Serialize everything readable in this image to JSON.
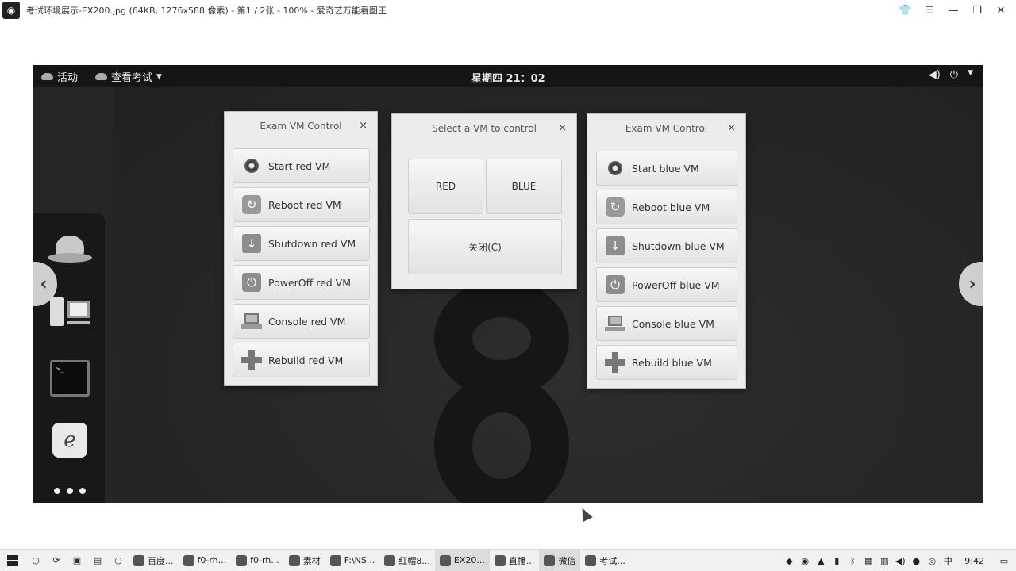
{
  "viewer": {
    "title": "考试环境展示-EX200.jpg (64KB, 1276x588 像素) - 第1 / 2张 - 100% - 爱奇艺万能看图王",
    "controls": [
      "shirt-icon",
      "menu-icon",
      "minimize-icon",
      "restore-icon",
      "close-icon"
    ]
  },
  "gnome": {
    "activities": "活动",
    "app_menu": "查看考试",
    "clock": "星期四 21：02",
    "volume_icon": "◀)",
    "power_icon": "⏻"
  },
  "dialogs": {
    "red": {
      "title": "Exam VM Control",
      "close": "×",
      "buttons": [
        {
          "label": "Start  red  VM",
          "icon": "start-icon"
        },
        {
          "label": "Reboot  red  VM",
          "icon": "reboot-icon"
        },
        {
          "label": "Shutdown  red  VM",
          "icon": "shutdown-icon"
        },
        {
          "label": "PowerOff  red  VM",
          "icon": "poweroff-icon"
        },
        {
          "label": "Console  red  VM",
          "icon": "console-icon"
        },
        {
          "label": "Rebuild  red  VM",
          "icon": "rebuild-icon"
        }
      ]
    },
    "select": {
      "title": "Select a VM to control",
      "close": "×",
      "red_label": "RED",
      "blue_label": "BLUE",
      "close_button": "关闭(C)"
    },
    "blue": {
      "title": "Exam VM Control",
      "close": "×",
      "buttons": [
        {
          "label": "Start  blue  VM",
          "icon": "start-icon"
        },
        {
          "label": "Reboot  blue  VM",
          "icon": "reboot-icon"
        },
        {
          "label": "Shutdown  blue  VM",
          "icon": "shutdown-icon"
        },
        {
          "label": "PowerOff  blue  VM",
          "icon": "poweroff-icon"
        },
        {
          "label": "Console  blue  VM",
          "icon": "console-icon"
        },
        {
          "label": "Rebuild  blue  VM",
          "icon": "rebuild-icon"
        }
      ]
    }
  },
  "taskbar": {
    "tasks": [
      "百度...",
      "f0-rh...",
      "f0-rh...",
      "素材",
      "F:\\NS...",
      "红帽8...",
      "EX20...",
      "直播...",
      "微信",
      "考试..."
    ],
    "clock": "9:42"
  }
}
